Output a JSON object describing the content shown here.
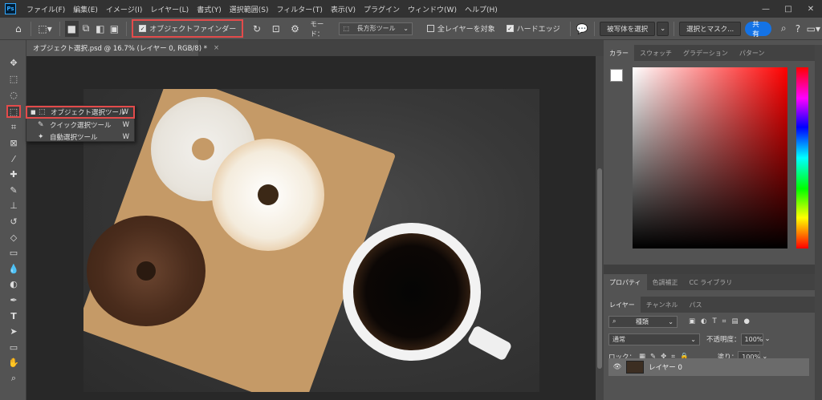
{
  "menu": {
    "logo": "Ps",
    "items": [
      "ファイル(F)",
      "編集(E)",
      "イメージ(I)",
      "レイヤー(L)",
      "書式(Y)",
      "選択範囲(S)",
      "フィルター(T)",
      "表示(V)",
      "プラグイン",
      "ウィンドウ(W)",
      "ヘルプ(H)"
    ],
    "window_controls": [
      "—",
      "□",
      "✕"
    ]
  },
  "options": {
    "object_finder_label": "オブジェクトファインダー",
    "mode_label": "モード：",
    "mode_value": "長方形ツール",
    "all_layers_label": "全レイヤーを対象",
    "hard_edge_label": "ハードエッジ",
    "select_subject_label": "被写体を選択",
    "select_mask_label": "選択とマスク...",
    "share_label": "共有"
  },
  "document": {
    "tab_title": "オブジェクト選択.psd @ 16.7% (レイヤー 0, RGB/8) *",
    "close": "×"
  },
  "flyout": {
    "items": [
      {
        "label": "オブジェクト選択ツール",
        "key": "W"
      },
      {
        "label": "クイック選択ツール",
        "key": "W"
      },
      {
        "label": "自動選択ツール",
        "key": "W"
      }
    ]
  },
  "color_panel": {
    "tabs": [
      "カラー",
      "スウォッチ",
      "グラデーション",
      "パターン"
    ]
  },
  "props_panel": {
    "tabs": [
      "プロパティ",
      "色調補正",
      "CC ライブラリ"
    ]
  },
  "layers_panel": {
    "tabs": [
      "レイヤー",
      "チャンネル",
      "パス"
    ],
    "filter_label": "種類",
    "blend_mode": "通常",
    "opacity_label": "不透明度：",
    "opacity_value": "100%",
    "lock_label": "ロック：",
    "fill_label": "塗り：",
    "fill_value": "100%",
    "layer_name": "レイヤー 0"
  },
  "colors": {
    "highlight": "#e34b4b",
    "share_button": "#1473e6"
  }
}
